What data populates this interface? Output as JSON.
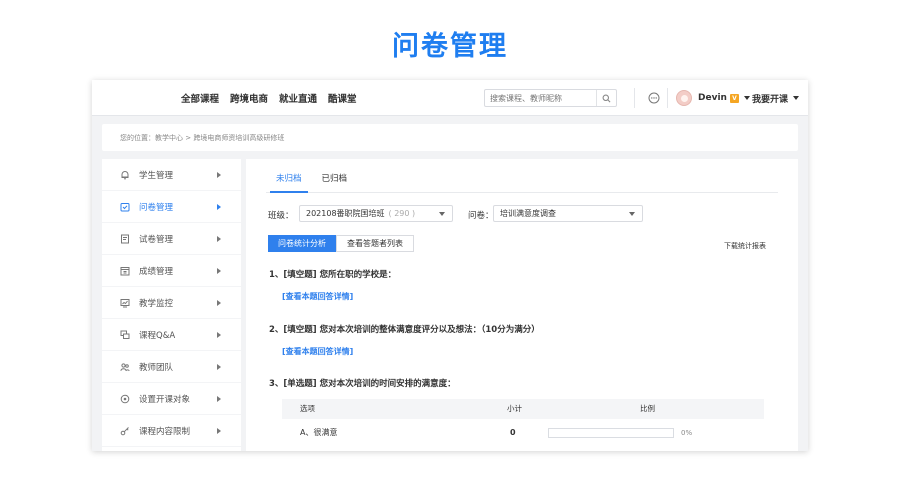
{
  "page_title": "问卷管理",
  "topnav": {
    "links": [
      "全部课程",
      "跨境电商",
      "就业直通",
      "酷课堂"
    ],
    "search_placeholder": "搜索课程、教师昵称",
    "username": "Devin",
    "vip_badge": "V",
    "open_course": "我要开课"
  },
  "breadcrumb": "您的位置：教学中心 > 跨境电商师资培训高级研修班",
  "sidebar": {
    "items": [
      {
        "label": "学生管理",
        "icon": "bell-icon",
        "active": false
      },
      {
        "label": "问卷管理",
        "icon": "survey-icon",
        "active": true
      },
      {
        "label": "试卷管理",
        "icon": "exam-paper-icon",
        "active": false
      },
      {
        "label": "成绩管理",
        "icon": "calendar-grid-icon",
        "active": false
      },
      {
        "label": "教学监控",
        "icon": "monitor-icon",
        "active": false
      },
      {
        "label": "课程Q&A",
        "icon": "chat-bubbles-icon",
        "active": false
      },
      {
        "label": "教师团队",
        "icon": "team-icon",
        "active": false
      },
      {
        "label": "设置开课对象",
        "icon": "target-icon",
        "active": false
      },
      {
        "label": "课程内容限制",
        "icon": "key-icon",
        "active": false
      }
    ]
  },
  "main": {
    "tabs": [
      "未归档",
      "已归档"
    ],
    "active_tab": 0,
    "class_label": "班级：",
    "class_value": "202108番职院国培班",
    "class_count": "( 290 )",
    "survey_label": "问卷：",
    "survey_value": "培训满意度调查",
    "view_tabs": [
      "问卷统计分析",
      "查看答题者列表"
    ],
    "download_label": "下载统计报表",
    "questions": [
      {
        "text": "1、[填空题] 您所在职的学校是：",
        "link": "[查看本题回答详情]"
      },
      {
        "text": "2、[填空题] 您对本次培训的整体满意度评分以及想法：（10分为满分）",
        "link": "[查看本题回答详情]"
      },
      {
        "text": "3、[单选题] 您对本次培训的时间安排的满意度：",
        "link": ""
      }
    ],
    "table": {
      "headers": [
        "选项",
        "小计",
        "比例"
      ],
      "rows": [
        {
          "option": "A、很满意",
          "count": "0",
          "ratio": "0%",
          "fraction": 0
        }
      ]
    }
  },
  "colors": {
    "accent": "#2f80ed",
    "title": "#1f7ef0",
    "vip": "#f5a623"
  }
}
